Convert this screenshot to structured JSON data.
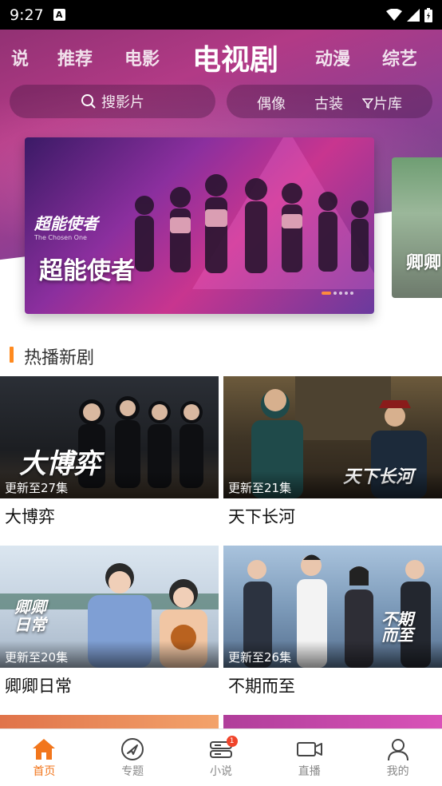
{
  "status_bar": {
    "time": "9:27",
    "notification_icon": "A"
  },
  "categories": [
    {
      "label": "说"
    },
    {
      "label": "推荐"
    },
    {
      "label": "电影"
    },
    {
      "label": "电视剧",
      "active": true
    },
    {
      "label": "动漫"
    },
    {
      "label": "综艺"
    }
  ],
  "search": {
    "placeholder": "搜影片"
  },
  "filters": {
    "idol": "偶像",
    "costume": "古装",
    "library": "片库"
  },
  "banner": {
    "logo_text": "超能使者",
    "logo_subtitle": "The Chosen One",
    "title": "超能使者",
    "next_title": "卿卿",
    "dots": 5,
    "active_dot": 0
  },
  "section": {
    "title": "热播新剧"
  },
  "shows": [
    {
      "title": "大博弈",
      "update": "更新至27集",
      "poster_text": "大博弈"
    },
    {
      "title": "天下长河",
      "update": "更新至21集",
      "poster_text": "天下长河"
    },
    {
      "title": "卿卿日常",
      "update": "更新至20集",
      "poster_text": "卿卿日常"
    },
    {
      "title": "不期而至",
      "update": "更新至26集",
      "poster_text": "不期而至"
    }
  ],
  "bottom_nav": [
    {
      "label": "首页",
      "icon": "home-icon",
      "active": true
    },
    {
      "label": "专题",
      "icon": "compass-icon"
    },
    {
      "label": "小说",
      "icon": "book-icon",
      "badge": "1"
    },
    {
      "label": "直播",
      "icon": "video-camera-icon"
    },
    {
      "label": "我的",
      "icon": "person-icon"
    }
  ],
  "colors": {
    "accent": "#f2761c",
    "badge": "#f0442b",
    "section_bar": "#ff8a1f"
  }
}
